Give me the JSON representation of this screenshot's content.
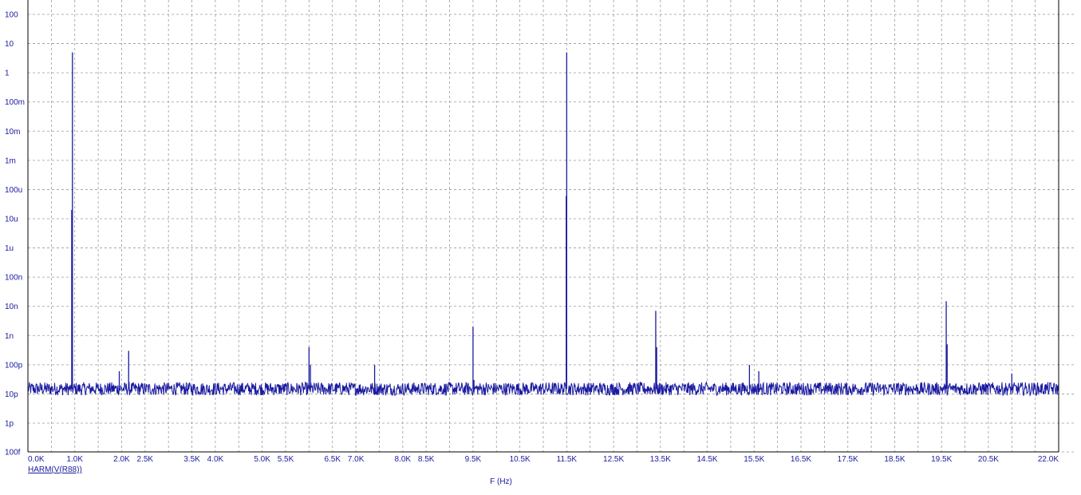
{
  "chart_data": {
    "type": "line",
    "trace_label": "HARM(V(R88))",
    "xlabel": "F (Hz)",
    "ylabel": "",
    "xlim": [
      0,
      22000
    ],
    "ylim": [
      1e-15,
      100
    ],
    "yscale": "log",
    "grid": true,
    "colors": {
      "trace": "#1a1aa0",
      "grid": "#9a9a9a",
      "axis": "#000000",
      "text": "#1a1aa0"
    },
    "x_ticks": [
      {
        "value": 0,
        "label": "0.0K"
      },
      {
        "value": 1000,
        "label": "1.0K"
      },
      {
        "value": 2000,
        "label": "2.0K"
      },
      {
        "value": 2500,
        "label": "2.5K"
      },
      {
        "value": 3500,
        "label": "3.5K"
      },
      {
        "value": 4000,
        "label": "4.0K"
      },
      {
        "value": 5000,
        "label": "5.0K"
      },
      {
        "value": 5500,
        "label": "5.5K"
      },
      {
        "value": 6500,
        "label": "6.5K"
      },
      {
        "value": 7000,
        "label": "7.0K"
      },
      {
        "value": 8000,
        "label": "8.0K"
      },
      {
        "value": 8500,
        "label": "8.5K"
      },
      {
        "value": 9500,
        "label": "9.5K"
      },
      {
        "value": 10500,
        "label": "10.5K"
      },
      {
        "value": 11500,
        "label": "11.5K"
      },
      {
        "value": 12500,
        "label": "12.5K"
      },
      {
        "value": 13500,
        "label": "13.5K"
      },
      {
        "value": 14500,
        "label": "14.5K"
      },
      {
        "value": 15500,
        "label": "15.5K"
      },
      {
        "value": 16500,
        "label": "16.5K"
      },
      {
        "value": 17500,
        "label": "17.5K"
      },
      {
        "value": 18500,
        "label": "18.5K"
      },
      {
        "value": 19500,
        "label": "19.5K"
      },
      {
        "value": 20500,
        "label": "20.5K"
      },
      {
        "value": 22000,
        "label": "22.0K"
      }
    ],
    "y_ticks": [
      {
        "value": 100,
        "label": "100"
      },
      {
        "value": 10,
        "label": "10"
      },
      {
        "value": 1,
        "label": "1"
      },
      {
        "value": 0.1,
        "label": "100m"
      },
      {
        "value": 0.01,
        "label": "10m"
      },
      {
        "value": 0.001,
        "label": "1m"
      },
      {
        "value": 0.0001,
        "label": "100u"
      },
      {
        "value": 1e-05,
        "label": "10u"
      },
      {
        "value": 1e-06,
        "label": "1u"
      },
      {
        "value": 1e-07,
        "label": "100n"
      },
      {
        "value": 1e-08,
        "label": "10n"
      },
      {
        "value": 1e-09,
        "label": "1n"
      },
      {
        "value": 1e-10,
        "label": "100p"
      },
      {
        "value": 1e-11,
        "label": "10p"
      },
      {
        "value": 1e-12,
        "label": "1p"
      },
      {
        "value": 1e-15,
        "label": "100f"
      }
    ],
    "noise_floor": 1.5e-11,
    "peaks": [
      {
        "x": 950,
        "y": 5
      },
      {
        "x": 935,
        "y": 2e-05
      },
      {
        "x": 1950,
        "y": 6e-11
      },
      {
        "x": 2150,
        "y": 3e-10
      },
      {
        "x": 6000,
        "y": 4e-10
      },
      {
        "x": 6030,
        "y": 1e-10
      },
      {
        "x": 7400,
        "y": 1e-10
      },
      {
        "x": 9500,
        "y": 2e-09
      },
      {
        "x": 9520,
        "y": 3e-11
      },
      {
        "x": 11500,
        "y": 5
      },
      {
        "x": 11490,
        "y": 6e-05
      },
      {
        "x": 13400,
        "y": 7e-09
      },
      {
        "x": 13420,
        "y": 4e-10
      },
      {
        "x": 15400,
        "y": 1e-10
      },
      {
        "x": 15600,
        "y": 6e-11
      },
      {
        "x": 19600,
        "y": 1.5e-08
      },
      {
        "x": 19620,
        "y": 5e-10
      },
      {
        "x": 21000,
        "y": 5e-11
      }
    ]
  }
}
